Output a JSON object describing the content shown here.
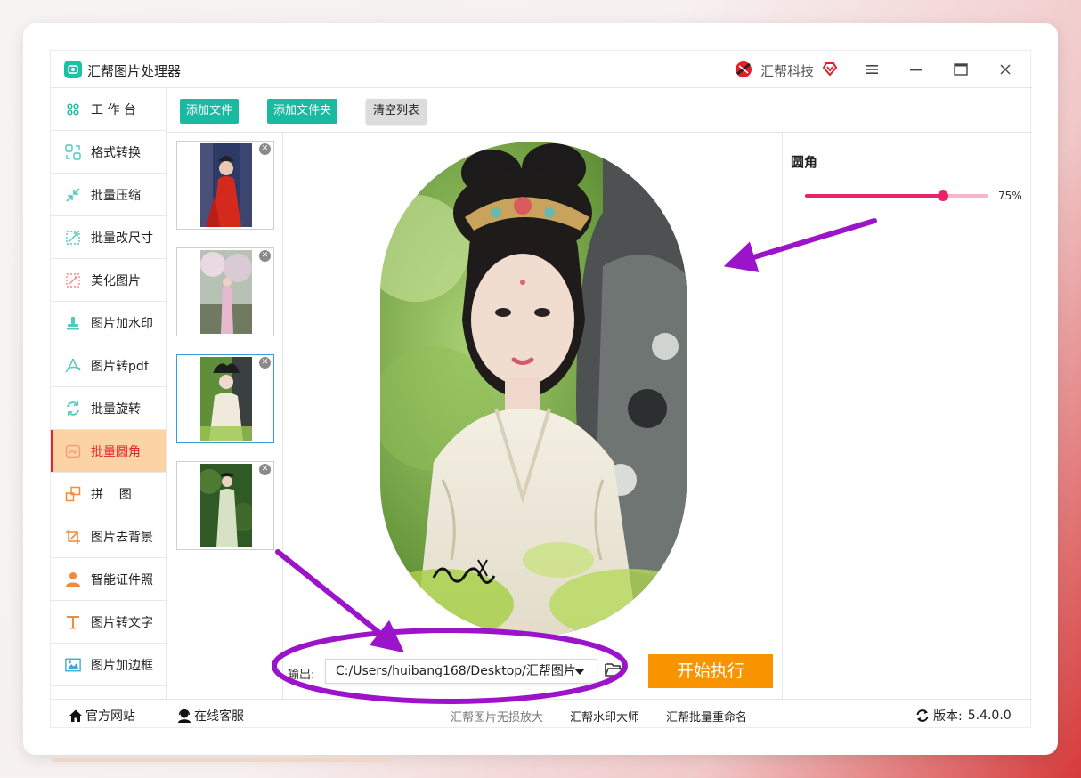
{
  "window": {
    "title": "汇帮图片处理器",
    "brand": "汇帮科技",
    "controls": {
      "menu": "≡",
      "minimize": "—",
      "maximize": "▭",
      "close": "✕"
    }
  },
  "sidebar": {
    "items": [
      {
        "label": "工 作 台",
        "icon": "grid-icon",
        "active": false
      },
      {
        "label": "格式转换",
        "icon": "convert-icon",
        "active": false
      },
      {
        "label": "批量压缩",
        "icon": "compress-icon",
        "active": false
      },
      {
        "label": "批量改尺寸",
        "icon": "resize-icon",
        "active": false
      },
      {
        "label": "美化图片",
        "icon": "beautify-icon",
        "active": false
      },
      {
        "label": "图片加水印",
        "icon": "watermark-icon",
        "active": false
      },
      {
        "label": "图片转pdf",
        "icon": "pdf-icon",
        "active": false
      },
      {
        "label": "批量旋转",
        "icon": "rotate-icon",
        "active": false
      },
      {
        "label": "批量圆角",
        "icon": "rounded-corner-icon",
        "active": true
      },
      {
        "label": "拼    图",
        "icon": "collage-icon",
        "active": false
      },
      {
        "label": "图片去背景",
        "icon": "crop-icon",
        "active": false
      },
      {
        "label": "智能证件照",
        "icon": "person-icon",
        "active": false
      },
      {
        "label": "图片转文字",
        "icon": "text-icon",
        "active": false
      },
      {
        "label": "图片加边框",
        "icon": "frame-icon",
        "active": false
      }
    ]
  },
  "toolbar": {
    "add_file": "添加文件",
    "add_folder": "添加文件夹",
    "clear_list": "清空列表"
  },
  "thumbnails": {
    "close_glyph": "✕",
    "selected_index": 2,
    "count": 4
  },
  "output": {
    "label": "输出:",
    "path": "C:/Users/huibang168/Desktop/汇帮图片",
    "start_button": "开始执行"
  },
  "settings": {
    "title": "圆角",
    "radius_percent": 75,
    "radius_text": "75%",
    "accent_color": "#e8236a",
    "track_color": "#f7b6c8"
  },
  "bottombar": {
    "website": "官方网站",
    "support": "在线客服",
    "links": [
      "汇帮图片无损放大",
      "汇帮水印大师",
      "汇帮批量重命名"
    ],
    "version_label": "版本:",
    "version": "5.4.0.0"
  },
  "colors": {
    "teal": "#1ab9a2",
    "orange": "#f99400",
    "active_bg": "#fbd3a5",
    "active_text": "#e6222a",
    "annotation": "#9b14c9"
  }
}
